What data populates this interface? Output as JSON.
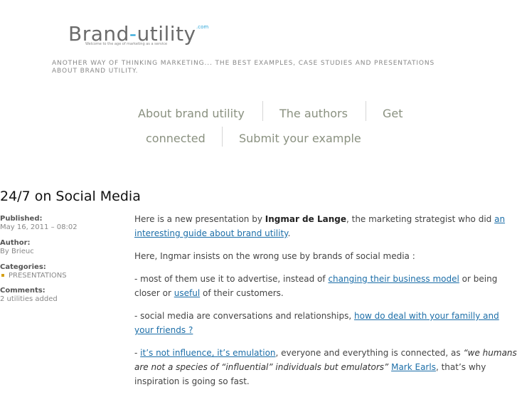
{
  "logo": {
    "name_part1": "Brand",
    "dash": "-",
    "name_part2": "utility",
    "com": ".com",
    "tagline": "Welcome to the age of marketing as a service"
  },
  "site_tagline": "ANOTHER WAY OF THINKING MARKETING... THE BEST EXAMPLES, CASE STUDIES AND PRESENTATIONS ABOUT BRAND UTILITY.",
  "nav": {
    "about": "About brand utility",
    "authors": "The authors",
    "get_1": "Get",
    "get_2": "connected",
    "submit": "Submit your example"
  },
  "post": {
    "title": "24/7 on Social Media",
    "published_label": "Published:",
    "published_value": "May 16, 2011 – 08:02",
    "author_label": "Author:",
    "author_value": "By Brieuc",
    "categories_label": "Categories:",
    "category_value": "PRESENTATIONS",
    "comments_label": "Comments:",
    "comments_value": "2 utilities added",
    "p1_a": "Here is a new presentation by ",
    "p1_b": "Ingmar de Lange",
    "p1_c": ", the marketing strategist who did ",
    "p1_link": "an interesting guide about brand utility",
    "p1_d": ".",
    "p2": "Here, Ingmar insists on the wrong use by brands of social media :",
    "p3_a": "- most of them use it to advertise, instead of ",
    "p3_link1": "changing their business model",
    "p3_b": " or being closer or ",
    "p3_link2": "useful",
    "p3_c": " of their customers.",
    "p4_a": "- social media are conversations and relationships, ",
    "p4_link": "how do deal with your familly and your friends ?",
    "p5_a": "- ",
    "p5_link1": "it’s not influence, it’s emulation",
    "p5_b": ", everyone and everything is connected, as ",
    "p5_quote": "“we humans are not a species of “influential” individuals but emulators”",
    "p5_c": " ",
    "p5_link2": "Mark Earls",
    "p5_d": ", that’s why inspiration is going so fast."
  }
}
